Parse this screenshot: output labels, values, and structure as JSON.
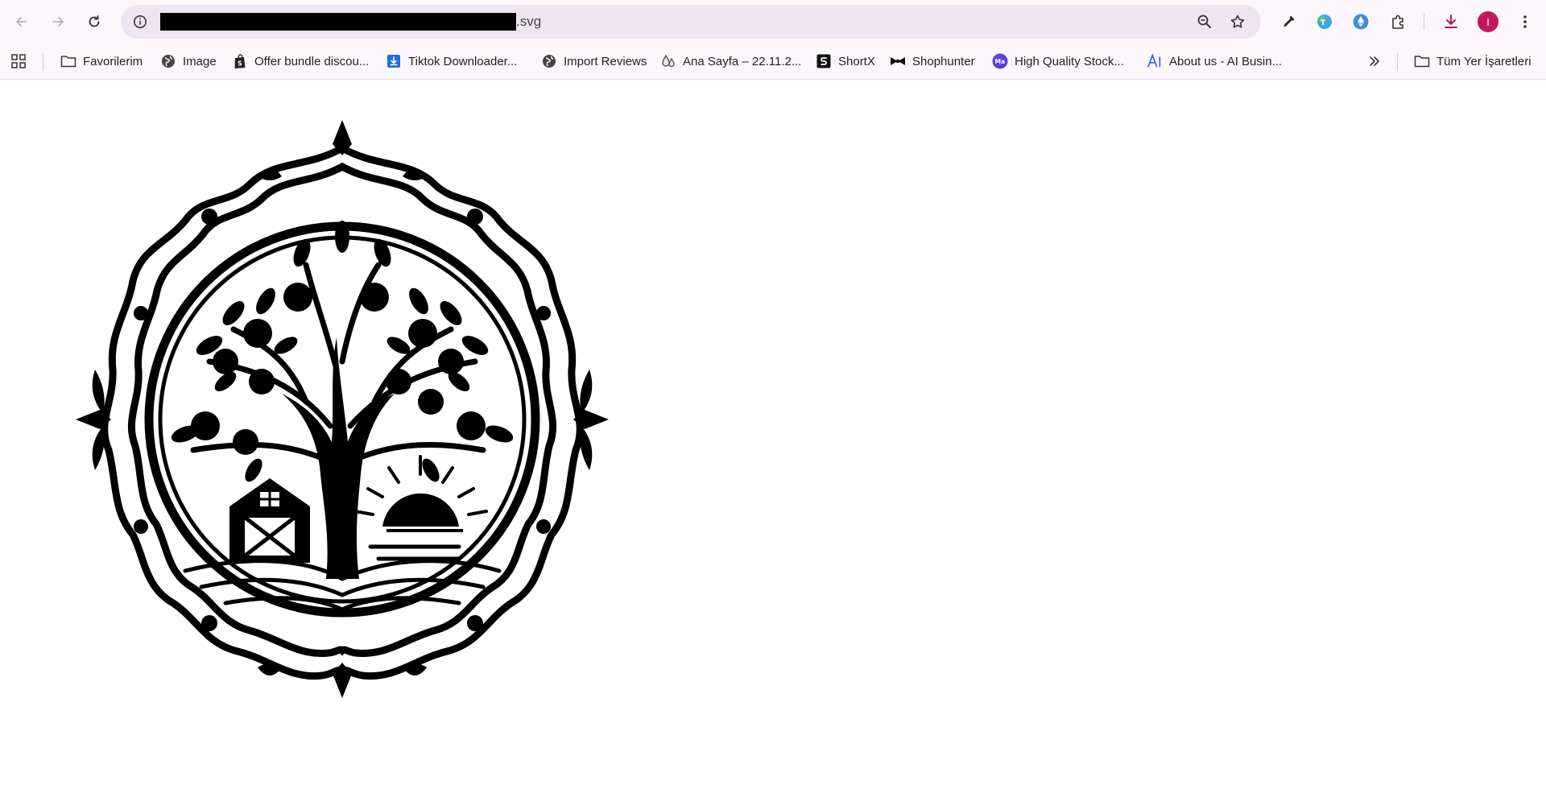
{
  "browser": {
    "url_suffix": ".svg",
    "profile_initial": "I",
    "accent_color": "#c2185b"
  },
  "toolbar": {
    "icons": [
      "back-icon",
      "forward-icon",
      "reload-icon",
      "site-info-icon",
      "zoom-icon",
      "bookmark-star-icon",
      "eyedropper-extension-icon",
      "translate-extension-icon",
      "ethereum-extension-icon",
      "extensions-puzzle-icon",
      "download-icon",
      "menu-kebab-icon"
    ]
  },
  "bookmarks": {
    "items": [
      {
        "label": "Favorilerim",
        "icon": "folder-icon"
      },
      {
        "label": "Image",
        "icon": "globe-icon"
      },
      {
        "label": "Offer bundle discou...",
        "icon": "shopify-icon"
      },
      {
        "label": "Tiktok Downloader...",
        "icon": "download-box-icon"
      },
      {
        "label": "Import Reviews",
        "icon": "globe-icon"
      },
      {
        "label": "Ana Sayfa – 22.11.2...",
        "icon": "drops-icon"
      },
      {
        "label": "ShortX",
        "icon": "shortx-icon"
      },
      {
        "label": "Shophunter",
        "icon": "bowtie-icon"
      },
      {
        "label": "High Quality Stock...",
        "icon": "ma-icon"
      },
      {
        "label": "About us - AI Busin...",
        "icon": "ai-icon"
      }
    ],
    "all_bookmarks_label": "Tüm Yer İşaretleri"
  },
  "content": {
    "image": "tree-of-life-mandala-svg"
  }
}
